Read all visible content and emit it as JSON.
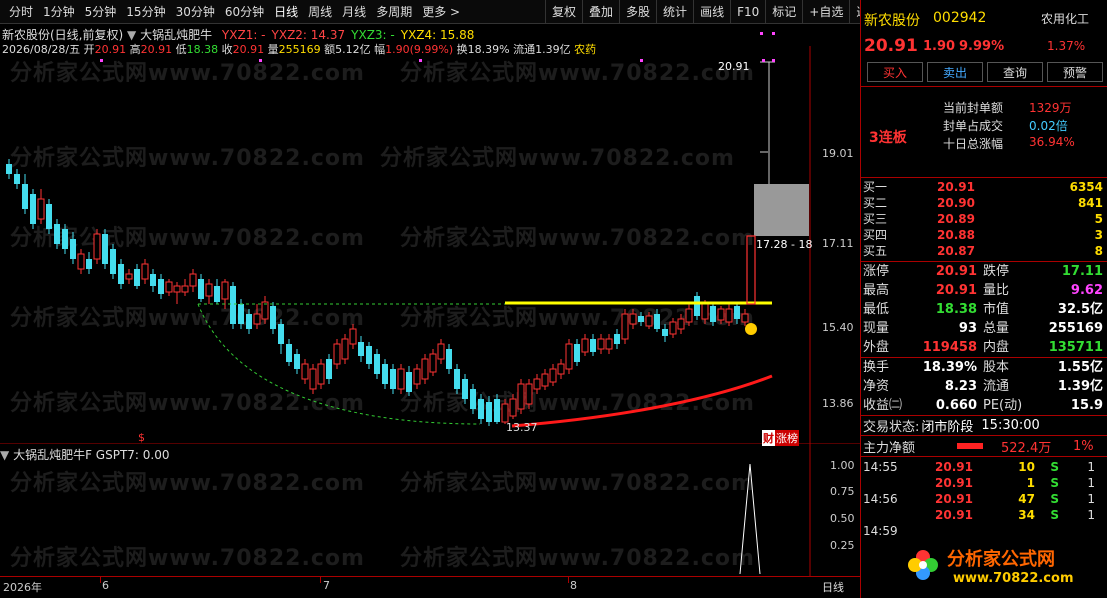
{
  "toolbar": {
    "periods": [
      "分时",
      "1分钟",
      "5分钟",
      "15分钟",
      "30分钟",
      "60分钟",
      "日线",
      "周线",
      "月线",
      "多周期",
      "更多 >"
    ],
    "tools": [
      "复权",
      "叠加",
      "多股",
      "统计",
      "画线",
      "F10",
      "标记",
      "+自选",
      "返回"
    ]
  },
  "chart": {
    "title": "新农股份(日线,前复权)",
    "indicator_name": "大锅乱炖肥牛",
    "indicator_values": [
      {
        "label": "YXZ1: -",
        "color": "#ff4444"
      },
      {
        "label": "YXZ2: 14.37",
        "color": "#ff4444"
      },
      {
        "label": "YXZ3: -",
        "color": "#33dd33"
      },
      {
        "label": "YXZ4: 15.88",
        "color": "#ffdd00"
      }
    ],
    "ohlc": {
      "date": "2026/08/28/五",
      "open_label": "开",
      "open": "20.91",
      "high_label": "高",
      "high": "20.91",
      "low_label": "低",
      "low": "18.38",
      "close_label": "收",
      "close": "20.91",
      "vol_label": "量",
      "vol": "255169",
      "amt_label": "额",
      "amt": "5.12亿",
      "chg_label": "幅",
      "chg": "1.90(9.99%)",
      "turn_label": "换",
      "turn": "18.39%",
      "float_label": "流通",
      "float": "1.39亿",
      "sector": "农药"
    },
    "y_ticks": [
      "19.01",
      "17.11",
      "15.40",
      "13.86"
    ],
    "annot_high": "20.91",
    "annot_mid": "17.28 - 18",
    "annot_low": "13.37",
    "badge_left": "财",
    "badge_right": "涨榜",
    "marker": "$",
    "watermark": "分析家公式网www.70822.com"
  },
  "sub": {
    "name": "大锅乱炖肥牛F",
    "value_label": "GSPT7: 0.00",
    "y_ticks": [
      "1.00",
      "0.75",
      "0.50",
      "0.25"
    ]
  },
  "xaxis": {
    "labels": [
      "2026年",
      "6",
      "7",
      "8"
    ],
    "period": "日线"
  },
  "panel": {
    "name": "新农股份",
    "code": "002942",
    "industry": "农用化工",
    "industry_chg": "1.37%",
    "price": "20.91",
    "chg": "1.90",
    "pct": "9.99%",
    "buttons": [
      "买入",
      "卖出",
      "查询",
      "预警"
    ],
    "streak": "3连板",
    "seal_label": "当前封单额",
    "seal_value": "1329万",
    "seal_ratio_label": "封单占成交",
    "seal_ratio_value": "0.02倍",
    "tenday_label": "十日总涨幅",
    "tenday_value": "36.94%",
    "quotes": [
      {
        "label": "买一",
        "price": "20.91",
        "vol": "6354"
      },
      {
        "label": "买二",
        "price": "20.90",
        "vol": "841"
      },
      {
        "label": "买三",
        "price": "20.89",
        "vol": "5"
      },
      {
        "label": "买四",
        "price": "20.88",
        "vol": "3"
      },
      {
        "label": "买五",
        "price": "20.87",
        "vol": "8"
      }
    ],
    "stats": [
      {
        "k": "涨停",
        "v": "20.91",
        "vc": "#ff3333",
        "k2": "跌停",
        "v2": "17.11",
        "v2c": "#33dd33"
      },
      {
        "k": "最高",
        "v": "20.91",
        "vc": "#ff3333",
        "k2": "量比",
        "v2": "9.62",
        "v2c": "#ff44ff"
      },
      {
        "k": "最低",
        "v": "18.38",
        "vc": "#33dd33",
        "k2": "市值",
        "v2": "32.5亿",
        "v2c": "#ffffff"
      },
      {
        "k": "现量",
        "v": "93",
        "vc": "#ffffff",
        "k2": "总量",
        "v2": "255169",
        "v2c": "#ffffff"
      },
      {
        "k": "外盘",
        "v": "119458",
        "vc": "#ff3333",
        "k2": "内盘",
        "v2": "135711",
        "v2c": "#33dd33"
      }
    ],
    "stats2": [
      {
        "k": "换手",
        "v": "18.39%",
        "vc": "#ffffff",
        "k2": "股本",
        "v2": "1.55亿",
        "v2c": "#ffffff"
      },
      {
        "k": "净资",
        "v": "8.23",
        "vc": "#ffffff",
        "k2": "流通",
        "v2": "1.39亿",
        "v2c": "#ffffff"
      },
      {
        "k": "收益㈡",
        "v": "0.660",
        "vc": "#ffffff",
        "k2": "PE(动)",
        "v2": "15.9",
        "v2c": "#ffffff"
      }
    ],
    "trade_status_label": "交易状态:",
    "trade_status": "闭市阶段",
    "trade_time": "15:30:00",
    "mainflow_label": "主力净额",
    "mainflow_value": "522.4万",
    "mainflow_pct": "1%",
    "ticks": [
      {
        "time": "14:55",
        "price": "20.91",
        "vol": "10",
        "side": "S",
        "n": "1"
      },
      {
        "time": "",
        "price": "20.91",
        "vol": "1",
        "side": "S",
        "n": "1"
      },
      {
        "time": "14:56",
        "price": "20.91",
        "vol": "47",
        "side": "S",
        "n": "1"
      },
      {
        "time": "",
        "price": "20.91",
        "vol": "34",
        "side": "S",
        "n": "1"
      },
      {
        "time": "14:59",
        "price": "",
        "vol": "",
        "side": "",
        "n": ""
      }
    ],
    "logo_text": "分析家公式网",
    "logo_url": "www.70822.com"
  }
}
